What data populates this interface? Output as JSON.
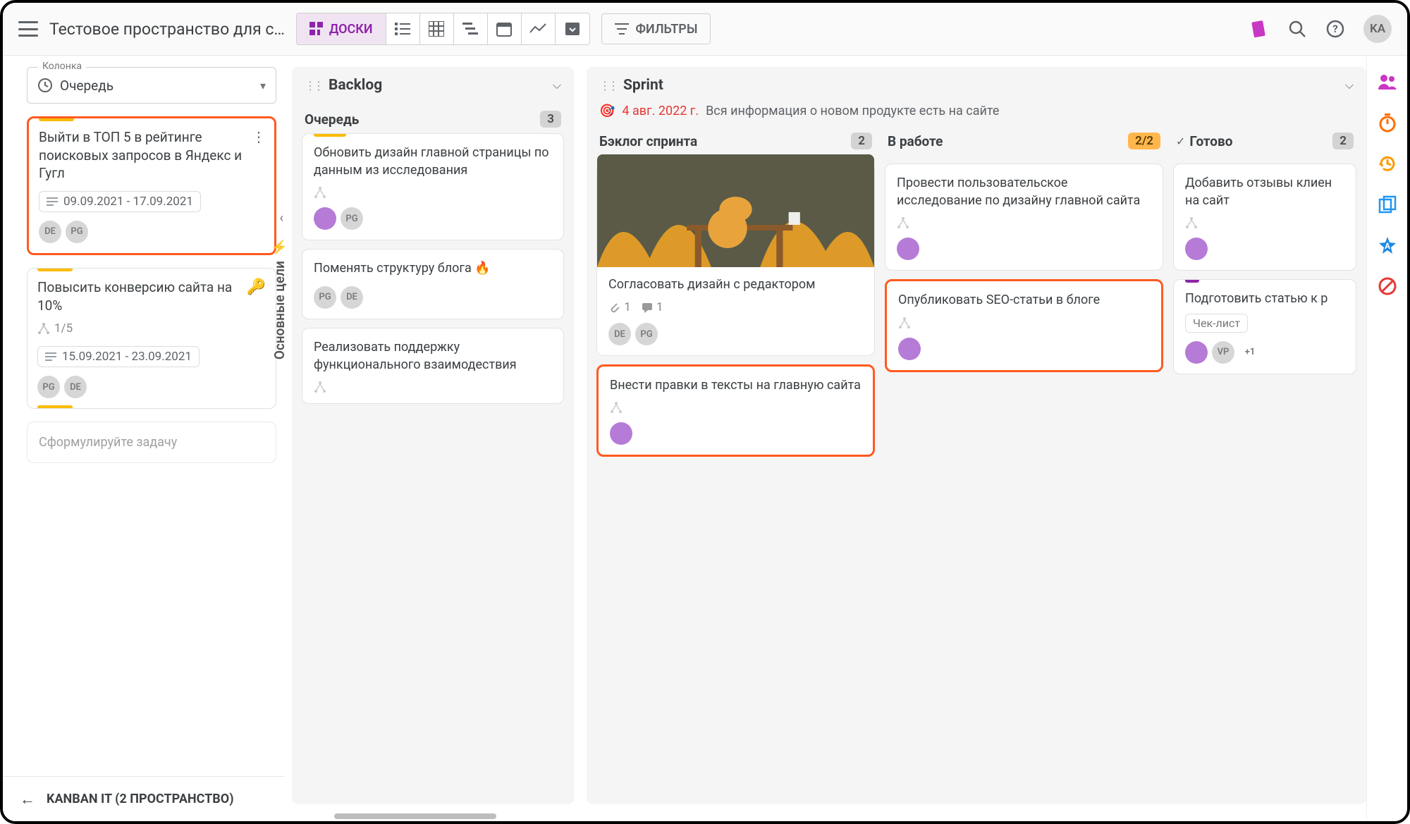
{
  "header": {
    "space_title": "Тестовое пространство для с…",
    "views": {
      "boards": "ДОСКИ"
    },
    "filters_label": "ФИЛЬТРЫ",
    "user_initials": "KA"
  },
  "sidebar": {
    "column_selector": {
      "label": "Колонка",
      "value": "Очередь"
    },
    "goals": [
      {
        "title": "Выйти в ТОП 5 в рейтинге поисковых запросов в Яндекс и Гугл",
        "date_range": "09.09.2021 - 17.09.2021",
        "avatars": [
          "DE",
          "PG"
        ],
        "selected": true
      },
      {
        "title": "Повысить конверсию сайта на 10%",
        "key": true,
        "subtasks": "1/5",
        "date_range": "15.09.2021 - 23.09.2021",
        "avatars": [
          "PG",
          "DE"
        ]
      }
    ],
    "compose_placeholder": "Сформулируйте задачу",
    "goals_tab": "Основные цели",
    "footer": "KANBAN IT (2 ПРОСТРАНСТВО)"
  },
  "backlog": {
    "title": "Backlog",
    "column_name": "Очередь",
    "count": "3",
    "cards": [
      {
        "title": "Обновить дизайн главной страницы по данным из исследования",
        "avatars_img": true,
        "avatars": [
          "PG"
        ]
      },
      {
        "title": "Поменять структуру блога 🔥",
        "avatars": [
          "PG",
          "DE"
        ]
      },
      {
        "title": "Реализовать поддержку функционального взаимодествия"
      }
    ]
  },
  "sprint": {
    "title": "Sprint",
    "date": "4 авг. 2022 г.",
    "desc": "Вся информация о новом продукте есть на сайте",
    "lanes": [
      {
        "name": "Бэклог спринта",
        "badge": "2",
        "cards": [
          {
            "image": true,
            "title": "Согласовать дизайн с редактором",
            "attachments": "1",
            "comments": "1",
            "avatars": [
              "DE",
              "PG"
            ]
          },
          {
            "title": "Внести правки в тексты на главную сайта",
            "avatar_img": true,
            "selected": true
          }
        ]
      },
      {
        "name": "В работе",
        "badge": "2/2",
        "badge_orange": true,
        "cards": [
          {
            "title": "Провести пользовательское исследование по дизайну главной сайта",
            "avatar_img": true
          },
          {
            "title": "Опубликовать SEO-статьи в блоге",
            "avatar_img": true,
            "selected": true
          }
        ]
      },
      {
        "name": "Готово",
        "check": true,
        "badge": "2",
        "cards": [
          {
            "title": "Добавить отзывы клиен на сайт",
            "avatar_img": true
          },
          {
            "title": "Подготовить статью к р",
            "checklist": "Чек-лист",
            "avatar_img": true,
            "avatars": [
              "VP"
            ],
            "more_count": "+1",
            "stripe_purple": true
          }
        ]
      }
    ]
  }
}
